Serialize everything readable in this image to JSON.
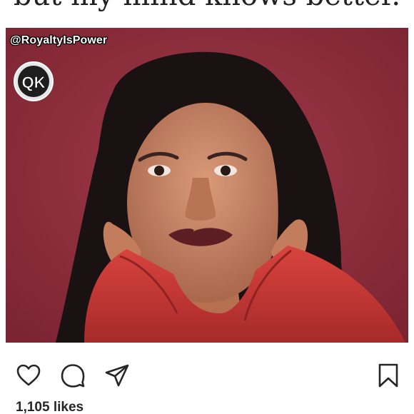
{
  "caption": {
    "text": "but my mind knows better."
  },
  "photo": {
    "watermark_handle": "@RoyaltyIsPower",
    "logo_text": "QK"
  },
  "actions": {
    "like_icon": "heart-icon",
    "comment_icon": "comment-icon",
    "share_icon": "send-icon",
    "save_icon": "bookmark-icon"
  },
  "likes": {
    "text": "1,105 likes"
  }
}
